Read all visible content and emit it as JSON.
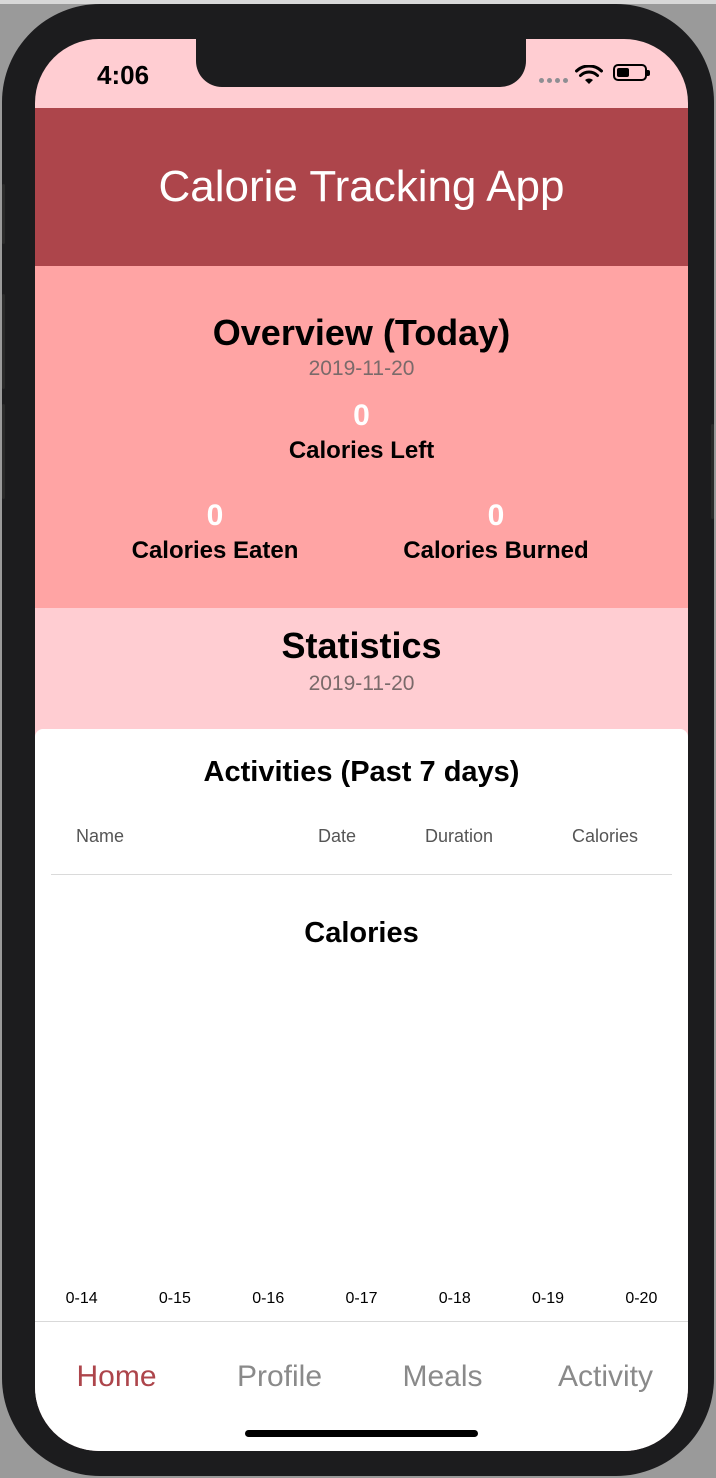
{
  "status_bar": {
    "time": "4:06"
  },
  "header": {
    "title": "Calorie Tracking App"
  },
  "overview": {
    "title": "Overview (Today)",
    "date": "2019-11-20",
    "calories_left_value": "0",
    "calories_left_label": "Calories Left",
    "calories_eaten_value": "0",
    "calories_eaten_label": "Calories Eaten",
    "calories_burned_value": "0",
    "calories_burned_label": "Calories Burned"
  },
  "statistics": {
    "title": "Statistics",
    "date": "2019-11-20"
  },
  "activities": {
    "title": "Activities (Past 7 days)",
    "columns": [
      "Name",
      "Date",
      "Duration",
      "Calories"
    ],
    "rows": []
  },
  "chart_data": {
    "type": "bar",
    "title": "Calories",
    "categories": [
      "0-14",
      "0-15",
      "0-16",
      "0-17",
      "0-18",
      "0-19",
      "0-20"
    ],
    "values": [
      0,
      0,
      0,
      0,
      0,
      0,
      0
    ],
    "grid": false
  },
  "tabs": [
    {
      "label": "Home",
      "active": true
    },
    {
      "label": "Profile",
      "active": false
    },
    {
      "label": "Meals",
      "active": false
    },
    {
      "label": "Activity",
      "active": false
    }
  ],
  "colors": {
    "header": "#ad454b",
    "overview_bg": "#ffa4a4",
    "statistics_bg": "#ffcdd2",
    "active_tab": "#ad454b",
    "inactive_tab": "#8a8a8a"
  }
}
